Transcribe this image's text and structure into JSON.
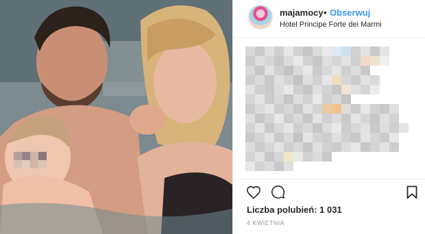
{
  "post": {
    "username": "majamocy",
    "separator": "•",
    "follow_label": "Obserwuj",
    "location": "Hotel Principe Forte dei Marmi",
    "likes_text": "Liczba polubień: 1 031",
    "date": "4 KWIETNIA"
  },
  "icons": {
    "like": "heart-icon",
    "comment": "comment-icon",
    "save": "bookmark-icon",
    "avatar": "avatar"
  },
  "colors": {
    "follow": "#3897f0",
    "text": "#262626",
    "muted": "#999999",
    "divider": "#efefef"
  }
}
